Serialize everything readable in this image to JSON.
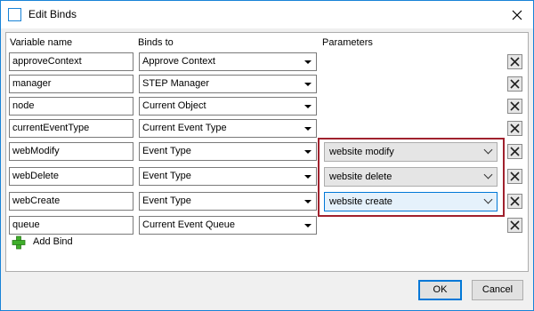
{
  "window": {
    "title": "Edit Binds"
  },
  "headers": {
    "variable_name": "Variable name",
    "binds_to": "Binds to",
    "parameters": "Parameters"
  },
  "rows": [
    {
      "variable": "approveContext",
      "binds_to": "Approve Context"
    },
    {
      "variable": "manager",
      "binds_to": "STEP Manager"
    },
    {
      "variable": "node",
      "binds_to": "Current Object"
    },
    {
      "variable": "currentEventType",
      "binds_to": "Current Event Type"
    },
    {
      "variable": "webModify",
      "binds_to": "Event Type",
      "parameter": "website modify"
    },
    {
      "variable": "webDelete",
      "binds_to": "Event Type",
      "parameter": "website delete"
    },
    {
      "variable": "webCreate",
      "binds_to": "Event Type",
      "parameter": "website create"
    },
    {
      "variable": "queue",
      "binds_to": "Current Event Queue"
    }
  ],
  "add_bind_label": "Add Bind",
  "buttons": {
    "ok": "OK",
    "cancel": "Cancel"
  },
  "icons": {
    "window": "window-icon",
    "close": "close-icon",
    "delete": "delete-x-icon",
    "add": "plus-icon",
    "dropdown": "chevron-down-icon"
  },
  "colors": {
    "accent": "#0078d7",
    "highlight_box": "#a0212d",
    "add_icon_green": "#3fae2a"
  }
}
